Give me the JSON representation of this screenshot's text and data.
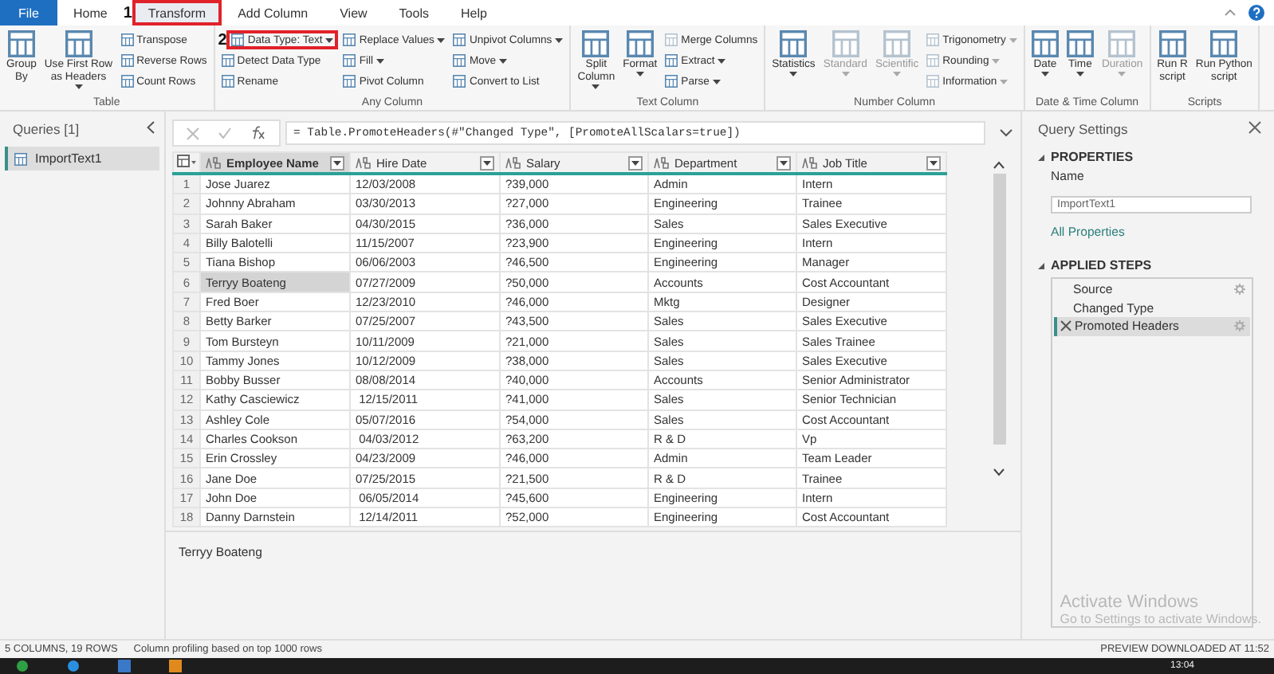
{
  "menu": {
    "tabs": [
      {
        "label": "File",
        "kind": "file",
        "selected": false
      },
      {
        "label": "Home",
        "kind": "tab",
        "selected": false
      },
      {
        "label": "Transform",
        "kind": "tab",
        "selected": true,
        "annotation": "1"
      },
      {
        "label": "Add Column",
        "kind": "tab",
        "selected": false
      },
      {
        "label": "View",
        "kind": "tab",
        "selected": false
      },
      {
        "label": "Tools",
        "kind": "tab",
        "selected": false
      },
      {
        "label": "Help",
        "kind": "tab",
        "selected": false
      }
    ]
  },
  "ribbon": {
    "groups": [
      {
        "label": "Table",
        "buttons": [
          {
            "kind": "large",
            "label": "Group\nBy",
            "dropdown": false,
            "disabled": false
          },
          {
            "kind": "large",
            "label": "Use First Row\nas Headers",
            "dropdown": true,
            "disabled": false
          },
          {
            "kind": "small",
            "label": "Transpose",
            "dropdown": false,
            "disabled": false
          },
          {
            "kind": "small",
            "label": "Reverse Rows",
            "dropdown": false,
            "disabled": false
          },
          {
            "kind": "small",
            "label": "Count Rows",
            "dropdown": false,
            "disabled": false
          }
        ]
      },
      {
        "label": "Any Column",
        "buttons": [
          {
            "kind": "small",
            "label": "Data Type: Text",
            "dropdown": true,
            "disabled": false,
            "annotation": "2"
          },
          {
            "kind": "small",
            "label": "Detect Data Type",
            "dropdown": false,
            "disabled": false
          },
          {
            "kind": "small",
            "label": "Rename",
            "dropdown": false,
            "disabled": false
          },
          {
            "kind": "small",
            "label": "Replace Values",
            "dropdown": true,
            "disabled": false
          },
          {
            "kind": "small",
            "label": "Fill",
            "dropdown": true,
            "disabled": false
          },
          {
            "kind": "small",
            "label": "Pivot Column",
            "dropdown": false,
            "disabled": false
          },
          {
            "kind": "small",
            "label": "Unpivot Columns",
            "dropdown": true,
            "disabled": false
          },
          {
            "kind": "small",
            "label": "Move",
            "dropdown": true,
            "disabled": false
          },
          {
            "kind": "small",
            "label": "Convert to List",
            "dropdown": false,
            "disabled": false
          }
        ]
      },
      {
        "label": "Text Column",
        "buttons": [
          {
            "kind": "large",
            "label": "Split\nColumn",
            "dropdown": true,
            "disabled": false
          },
          {
            "kind": "large",
            "label": "Format",
            "dropdown": true,
            "disabled": false
          },
          {
            "kind": "small",
            "label": "Merge Columns",
            "dropdown": false,
            "disabled": true
          },
          {
            "kind": "small",
            "label": "Extract",
            "dropdown": true,
            "disabled": false
          },
          {
            "kind": "small",
            "label": "Parse",
            "dropdown": true,
            "disabled": false
          }
        ]
      },
      {
        "label": "Number Column",
        "buttons": [
          {
            "kind": "large",
            "label": "Statistics",
            "dropdown": true,
            "disabled": false
          },
          {
            "kind": "large",
            "label": "Standard",
            "dropdown": true,
            "disabled": true
          },
          {
            "kind": "large",
            "label": "Scientific",
            "dropdown": true,
            "disabled": true
          },
          {
            "kind": "small",
            "label": "Trigonometry",
            "dropdown": true,
            "disabled": true
          },
          {
            "kind": "small",
            "label": "Rounding",
            "dropdown": true,
            "disabled": true
          },
          {
            "kind": "small",
            "label": "Information",
            "dropdown": true,
            "disabled": true
          }
        ]
      },
      {
        "label": "Date & Time Column",
        "buttons": [
          {
            "kind": "large",
            "label": "Date",
            "dropdown": true,
            "disabled": false
          },
          {
            "kind": "large",
            "label": "Time",
            "dropdown": true,
            "disabled": false
          },
          {
            "kind": "large",
            "label": "Duration",
            "dropdown": true,
            "disabled": true
          }
        ]
      },
      {
        "label": "Scripts",
        "buttons": [
          {
            "kind": "large",
            "label": "Run R\nscript",
            "dropdown": false,
            "disabled": false
          },
          {
            "kind": "large",
            "label": "Run Python\nscript",
            "dropdown": false,
            "disabled": false
          }
        ]
      }
    ]
  },
  "queries": {
    "title": "Queries [1]",
    "items": [
      {
        "label": "ImportText1",
        "selected": true
      }
    ]
  },
  "formula": {
    "text": "= Table.PromoteHeaders(#\"Changed Type\", [PromoteAllScalars=true])"
  },
  "table": {
    "columns": [
      "Employee Name",
      "Hire Date",
      "Salary",
      "Department",
      "Job Title"
    ],
    "rows": [
      {
        "number": "1",
        "cells": [
          "Jose Juarez",
          "12/03/2008",
          "?39,000",
          "Admin",
          "Intern"
        ],
        "selected": false
      },
      {
        "number": "2",
        "cells": [
          "Johnny Abraham",
          "03/30/2013",
          "?27,000",
          "Engineering",
          "Trainee"
        ],
        "selected": false
      },
      {
        "number": "3",
        "cells": [
          "Sarah Baker",
          "04/30/2015",
          "?36,000",
          "Sales",
          "Sales Executive"
        ],
        "selected": false
      },
      {
        "number": "4",
        "cells": [
          "Billy Balotelli",
          "11/15/2007",
          "?23,900",
          "Engineering",
          "Intern"
        ],
        "selected": false
      },
      {
        "number": "5",
        "cells": [
          "Tiana Bishop",
          "06/06/2003",
          "?46,500",
          "Engineering",
          "Manager"
        ],
        "selected": false
      },
      {
        "number": "6",
        "cells": [
          "Terryy Boateng",
          "07/27/2009",
          "?50,000",
          "Accounts",
          "Cost Accountant"
        ],
        "selected": true
      },
      {
        "number": "7",
        "cells": [
          "Fred Boer",
          "12/23/2010",
          "?46,000",
          "Mktg",
          "Designer"
        ],
        "selected": false
      },
      {
        "number": "8",
        "cells": [
          "Betty Barker",
          "07/25/2007",
          "?43,500",
          "Sales",
          "Sales Executive"
        ],
        "selected": false
      },
      {
        "number": "9",
        "cells": [
          "Tom Bursteyn",
          "10/11/2009",
          "?21,000",
          "Sales",
          "Sales Trainee"
        ],
        "selected": false
      },
      {
        "number": "10",
        "cells": [
          "Tammy Jones",
          "10/12/2009",
          "?38,000",
          "Sales",
          "Sales Executive"
        ],
        "selected": false
      },
      {
        "number": "11",
        "cells": [
          "Bobby Busser",
          "08/08/2014",
          "?40,000",
          "Accounts",
          "Senior Administrator"
        ],
        "selected": false
      },
      {
        "number": "12",
        "cells": [
          "Kathy Casciewicz",
          " 12/15/2011",
          "?41,000",
          "Sales",
          "Senior Technician"
        ],
        "selected": false
      },
      {
        "number": "13",
        "cells": [
          "Ashley Cole",
          "05/07/2016",
          "?54,000",
          "Sales",
          "Cost Accountant"
        ],
        "selected": false
      },
      {
        "number": "14",
        "cells": [
          "Charles Cookson",
          " 04/03/2012",
          "?63,200",
          "R & D",
          "Vp"
        ],
        "selected": false
      },
      {
        "number": "15",
        "cells": [
          "Erin Crossley",
          "04/23/2009",
          "?46,000",
          "Admin",
          "Team Leader"
        ],
        "selected": false
      },
      {
        "number": "16",
        "cells": [
          "Jane Doe",
          "07/25/2015",
          "?21,500",
          "R & D",
          "Trainee"
        ],
        "selected": false
      },
      {
        "number": "17",
        "cells": [
          "John Doe",
          " 06/05/2014",
          "?45,600",
          "Engineering",
          "Intern"
        ],
        "selected": false
      },
      {
        "number": "18",
        "cells": [
          "Danny Darnstein",
          " 12/14/2011",
          "?52,000",
          "Engineering",
          "Cost Accountant"
        ],
        "selected": false
      }
    ]
  },
  "preview": {
    "text": "Terryy Boateng"
  },
  "settings": {
    "title": "Query Settings",
    "properties_heading": "PROPERTIES",
    "name_label": "Name",
    "name_value": "ImportText1",
    "all_properties": "All Properties",
    "steps_heading": "APPLIED STEPS",
    "steps": [
      {
        "label": "Source",
        "selected": false,
        "settings": true,
        "deletable": false
      },
      {
        "label": "Changed Type",
        "selected": false,
        "settings": false,
        "deletable": false
      },
      {
        "label": "Promoted Headers",
        "selected": true,
        "settings": true,
        "deletable": true
      }
    ]
  },
  "os_notice": {
    "title": "Activate Windows",
    "text": "Go to Settings to activate Windows."
  },
  "status_bar": {
    "left": [
      "5 COLUMNS, 19 ROWS",
      "Column profiling based on top 1000 rows"
    ],
    "right": "PREVIEW DOWNLOADED AT 11:52"
  },
  "taskbar": {
    "clock": "13:04"
  }
}
